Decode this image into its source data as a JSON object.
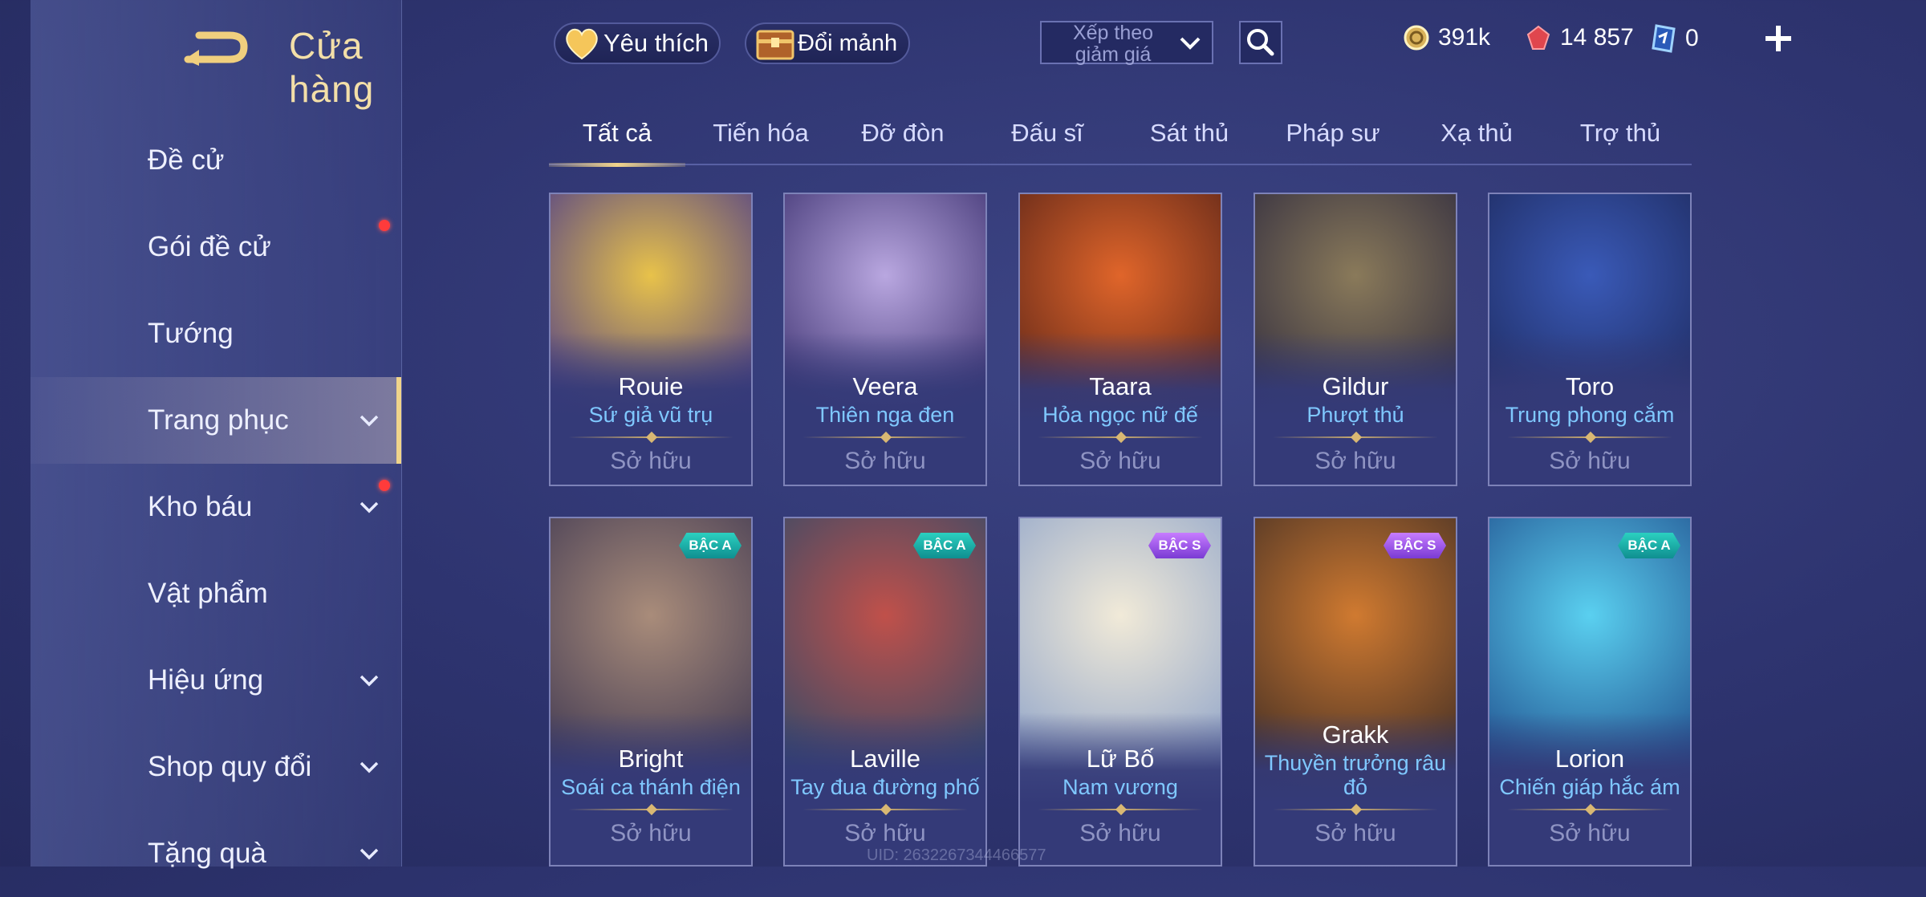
{
  "header": {
    "title": "Cửa hàng",
    "favorite_label": "Yêu thích",
    "exchange_label": "Đổi mảnh",
    "sort_label": "Xếp theo giảm giá",
    "currencies": [
      {
        "icon": "gold-coin-icon",
        "value": "391k"
      },
      {
        "icon": "ruby-icon",
        "value": "14 857"
      },
      {
        "icon": "voucher-icon",
        "value": "0"
      }
    ]
  },
  "sidebar": {
    "items": [
      {
        "label": "Đề cử",
        "chevron": false,
        "dot": false,
        "active": false
      },
      {
        "label": "Gói đề cử",
        "chevron": false,
        "dot": true,
        "active": false
      },
      {
        "label": "Tướng",
        "chevron": false,
        "dot": false,
        "active": false
      },
      {
        "label": "Trang phục",
        "chevron": true,
        "dot": false,
        "active": true
      },
      {
        "label": "Kho báu",
        "chevron": true,
        "dot": true,
        "active": false
      },
      {
        "label": "Vật phẩm",
        "chevron": false,
        "dot": false,
        "active": false
      },
      {
        "label": "Hiệu ứng",
        "chevron": true,
        "dot": false,
        "active": false
      },
      {
        "label": "Shop quy đổi",
        "chevron": true,
        "dot": false,
        "active": false
      },
      {
        "label": "Tặng quà",
        "chevron": true,
        "dot": false,
        "active": false
      }
    ]
  },
  "tabs": [
    "Tất cả",
    "Tiến hóa",
    "Đỡ đòn",
    "Đấu sĩ",
    "Sát thủ",
    "Pháp sư",
    "Xạ thủ",
    "Trợ thủ"
  ],
  "active_tab": 0,
  "cards": [
    {
      "hero": "Rouie",
      "skin": "Sứ giả vũ trụ",
      "status": "Sở hữu",
      "badge": "",
      "colors": [
        "#e8c24a",
        "#4a3a8a"
      ]
    },
    {
      "hero": "Veera",
      "skin": "Thiên nga đen",
      "status": "Sở hữu",
      "badge": "",
      "colors": [
        "#b9a7e0",
        "#3a2f6e"
      ]
    },
    {
      "hero": "Taara",
      "skin": "Hỏa ngọc nữ đế",
      "status": "Sở hữu",
      "badge": "",
      "colors": [
        "#e0652a",
        "#5a2418"
      ]
    },
    {
      "hero": "Gildur",
      "skin": "Phượt thủ",
      "status": "Sở hữu",
      "badge": "",
      "colors": [
        "#8a7a5a",
        "#2e2a3e"
      ]
    },
    {
      "hero": "Toro",
      "skin": "Trung phong cắm",
      "status": "Sở hữu",
      "badge": "",
      "colors": [
        "#3a5ab8",
        "#1e2a5e"
      ]
    },
    {
      "hero": "Bright",
      "skin": "Soái ca thánh điện",
      "status": "Sở hữu",
      "badge": "BẬC A",
      "colors": [
        "#a98c7a",
        "#3a3450"
      ]
    },
    {
      "hero": "Laville",
      "skin": "Tay đua đường phố",
      "status": "Sở hữu",
      "badge": "BẬC A",
      "colors": [
        "#c0504a",
        "#2a4a6a"
      ]
    },
    {
      "hero": "Lữ Bố",
      "skin": "Nam vương",
      "status": "Sở hữu",
      "badge": "BẬC S",
      "colors": [
        "#f1ead8",
        "#8aa0c8"
      ]
    },
    {
      "hero": "Grakk",
      "skin": "Thuyền trưởng râu đỏ",
      "status": "Sở hữu",
      "badge": "BẬC S",
      "colors": [
        "#d07a30",
        "#3a2a24"
      ]
    },
    {
      "hero": "Lorion",
      "skin": "Chiến giáp hắc ám",
      "status": "Sở hữu",
      "badge": "BẬC A",
      "colors": [
        "#5ad0f0",
        "#1e4a8a"
      ]
    }
  ],
  "uid": "UID: 2632267344466577"
}
